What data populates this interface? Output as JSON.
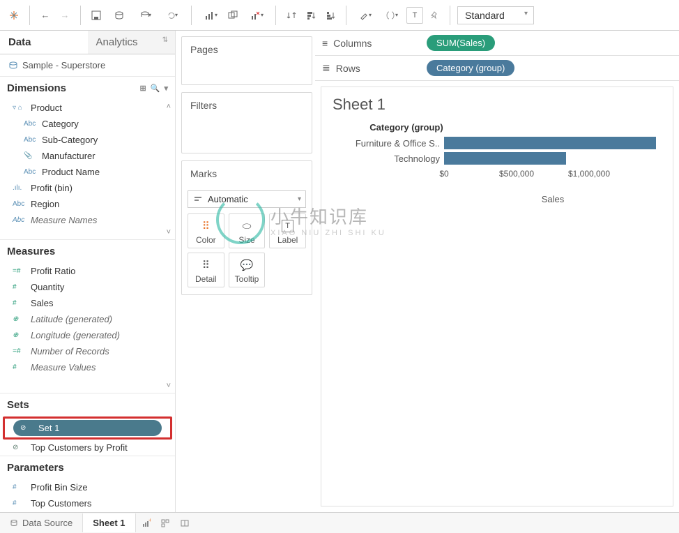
{
  "toolbar": {
    "fit_mode": "Standard"
  },
  "sidebar": {
    "tabs": {
      "data": "Data",
      "analytics": "Analytics"
    },
    "datasource": "Sample - Superstore",
    "sections": {
      "dimensions": "Dimensions",
      "measures": "Measures",
      "sets": "Sets",
      "parameters": "Parameters"
    },
    "dimensions": {
      "group": "Product",
      "items": [
        "Category",
        "Sub-Category",
        "Manufacturer",
        "Product Name"
      ],
      "extra": [
        "Profit (bin)",
        "Region",
        "Measure Names"
      ]
    },
    "measures": [
      "Profit Ratio",
      "Quantity",
      "Sales",
      "Latitude (generated)",
      "Longitude (generated)",
      "Number of Records",
      "Measure Values"
    ],
    "sets": [
      "Set 1",
      "Top Customers by Profit"
    ],
    "parameters": [
      "Profit Bin Size",
      "Top Customers"
    ]
  },
  "cards": {
    "pages": "Pages",
    "filters": "Filters",
    "marks": "Marks",
    "marks_type": "Automatic",
    "mark_cells": {
      "color": "Color",
      "size": "Size",
      "label": "Label",
      "detail": "Detail",
      "tooltip": "Tooltip"
    }
  },
  "shelves": {
    "columns": "Columns",
    "rows": "Rows",
    "columns_pill": "SUM(Sales)",
    "rows_pill": "Category (group)"
  },
  "viz": {
    "title": "Sheet 1",
    "axis_label": "Sales",
    "dimension_header": "Category (group)"
  },
  "chart_data": {
    "type": "bar",
    "categories": [
      "Furniture & Office S..",
      "Technology"
    ],
    "values": [
      1460000,
      840000
    ],
    "xlabel": "Sales",
    "ylabel": "Category (group)",
    "ticks": [
      0,
      500000,
      1000000
    ],
    "tick_labels": [
      "$0",
      "$500,000",
      "$1,000,000"
    ],
    "xmax": 1500000
  },
  "watermark": {
    "big": "小牛知识库",
    "small": "XIAO NIU ZHI SHI KU"
  },
  "bottom": {
    "datasource": "Data Source",
    "sheet": "Sheet 1"
  }
}
